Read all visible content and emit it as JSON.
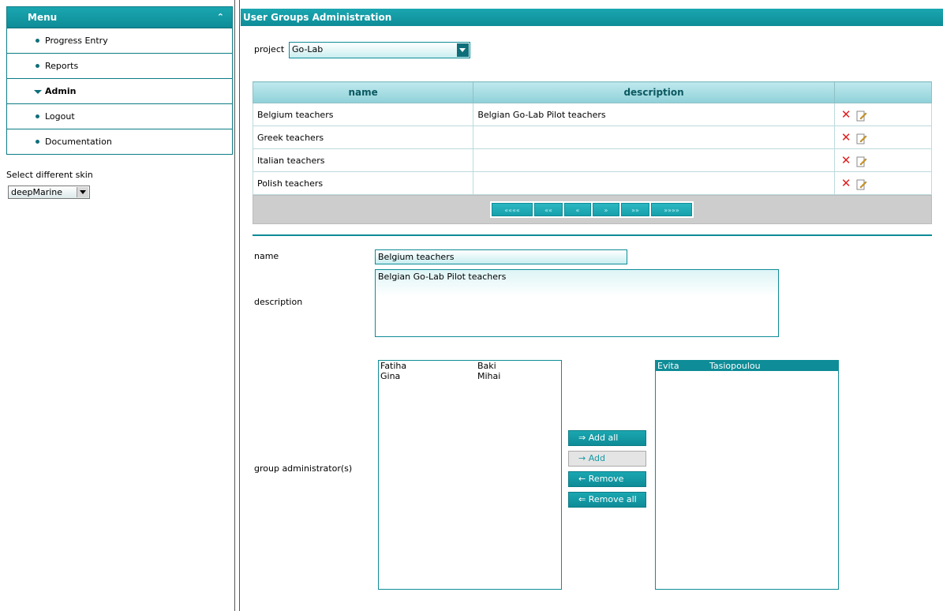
{
  "sidebar": {
    "title": "Menu",
    "items": [
      {
        "label": "Progress Entry",
        "active": false
      },
      {
        "label": "Reports",
        "active": false
      },
      {
        "label": "Admin",
        "active": true
      },
      {
        "label": "Logout",
        "active": false
      },
      {
        "label": "Documentation",
        "active": false
      }
    ],
    "skin_label": "Select different skin",
    "skin_value": "deepMarine"
  },
  "main": {
    "title": "User Groups Administration",
    "project_label": "project",
    "project_value": "Go-Lab",
    "table": {
      "columns": [
        "name",
        "description",
        ""
      ],
      "rows": [
        {
          "name": "Belgium teachers",
          "description": "Belgian Go-Lab Pilot teachers"
        },
        {
          "name": "Greek teachers",
          "description": ""
        },
        {
          "name": "Italian teachers",
          "description": ""
        },
        {
          "name": "Polish teachers",
          "description": ""
        }
      ]
    },
    "pager": [
      "««««",
      "««",
      "«",
      "»",
      "»»",
      "»»»»"
    ],
    "form": {
      "name_label": "name",
      "name_value": "Belgium teachers",
      "description_label": "description",
      "description_value": "Belgian Go-Lab Pilot teachers",
      "admins_label": "group administrator(s)",
      "available": [
        {
          "first": "Fatiha",
          "last": "Baki"
        },
        {
          "first": "Gina",
          "last": "Mihai"
        }
      ],
      "selected": [
        {
          "first": "Evita",
          "last": "Tasiopoulou"
        }
      ],
      "buttons": {
        "add_all": "⇒ Add all",
        "add": "→ Add",
        "remove": "← Remove",
        "remove_all": "⇐ Remove all"
      }
    }
  },
  "colors": {
    "accent": "#0e8c97",
    "header_gradient_top": "#1aa7b1",
    "delete_icon": "#e02020"
  }
}
